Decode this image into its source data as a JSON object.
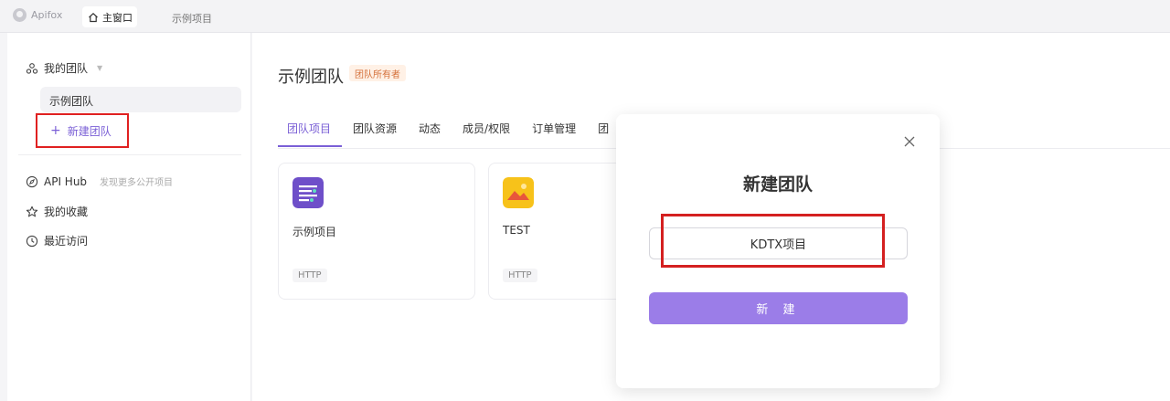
{
  "titlebar": {
    "app_name": "Apifox",
    "main_tab": "主窗口",
    "project_tab": "示例项目"
  },
  "sidebar": {
    "team_header": "我的团队",
    "team_item": "示例团队",
    "new_team": "新建团队",
    "api_hub": "API Hub",
    "api_hub_sub": "发现更多公开项目",
    "favorites": "我的收藏",
    "recent": "最近访问"
  },
  "main": {
    "title": "示例团队",
    "owner_badge": "团队所有者",
    "tabs": [
      "团队项目",
      "团队资源",
      "动态",
      "成员/权限",
      "订单管理",
      "团"
    ],
    "cards": [
      {
        "title": "示例项目",
        "tag": "HTTP",
        "icon": "doc-list-icon"
      },
      {
        "title": "TEST",
        "tag": "HTTP",
        "icon": "image-icon"
      }
    ]
  },
  "modal": {
    "title": "新建团队",
    "input_value": "KDTX项目",
    "create_label": "新 建"
  },
  "colors": {
    "accent": "#7a5fd6",
    "button": "#9b7de8",
    "highlight_box": "#d42020"
  }
}
